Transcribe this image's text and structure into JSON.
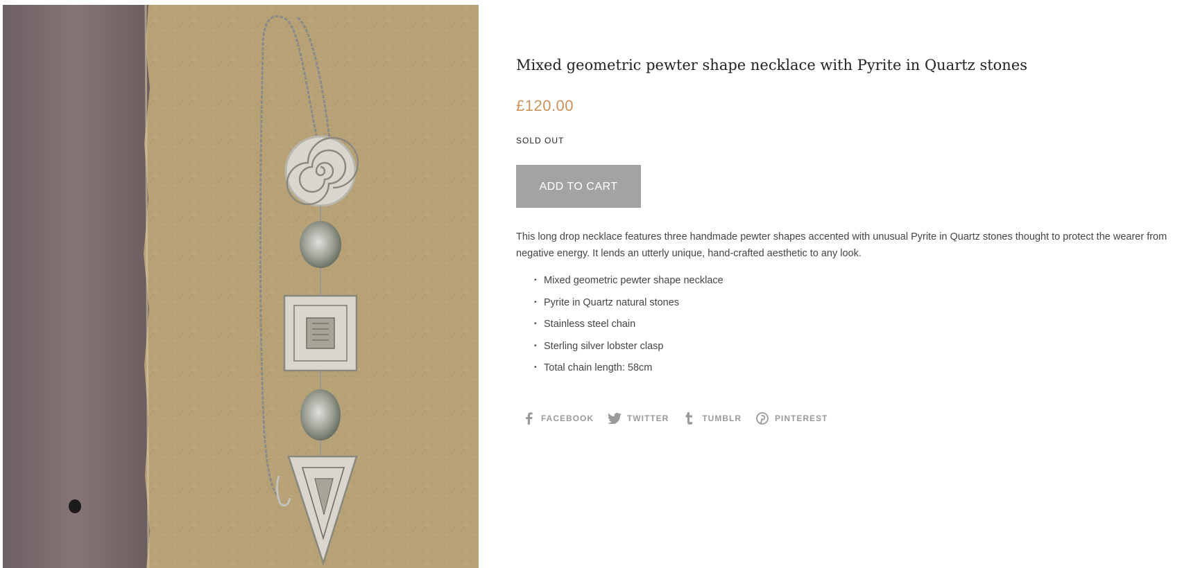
{
  "product": {
    "title": "Mixed geometric pewter shape necklace with Pyrite in Quartz stones",
    "price": "£120.00",
    "stock_status": "SOLD OUT",
    "add_to_cart_label": "ADD TO CART",
    "description": "This long drop necklace features three handmade pewter shapes accented with unusual Pyrite in Quartz stones thought to protect the wearer from negative energy. It lends an utterly unique, hand-crafted aesthetic to any look.",
    "features": [
      "Mixed geometric pewter shape necklace",
      "Pyrite in Quartz natural stones",
      "Stainless steel chain",
      "Sterling silver lobster clasp",
      "Total chain length: 58cm"
    ],
    "image_icon": "necklace-photo"
  },
  "share": [
    {
      "label": "FACEBOOK",
      "icon": "facebook-icon"
    },
    {
      "label": "TWITTER",
      "icon": "twitter-icon"
    },
    {
      "label": "TUMBLR",
      "icon": "tumblr-icon"
    },
    {
      "label": "PINTEREST",
      "icon": "pinterest-icon"
    }
  ],
  "colors": {
    "price": "#c9925a",
    "button": "#a3a3a3",
    "share": "#9a9a9a",
    "background_paper": "#b7a277",
    "background_wood": "#776a69"
  }
}
